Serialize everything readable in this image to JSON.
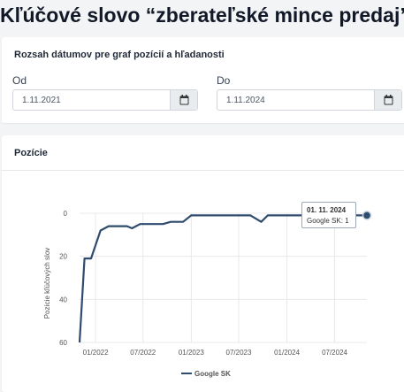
{
  "page": {
    "title": "Kľúčové slovo “zberateľské mince predaj”"
  },
  "date_range": {
    "title": "Rozsah dátumov pre graf pozícií a hľadanosti",
    "from_label": "Od",
    "from_value": "1.11.2021",
    "to_label": "Do",
    "to_value": "1.11.2024"
  },
  "positions_card": {
    "title": "Pozície"
  },
  "tooltip": {
    "date": "01. 11. 2024",
    "text": "Google SK: 1"
  },
  "colors": {
    "series": "#2f4b6e",
    "grid": "#e8e8e8"
  },
  "chart_data": {
    "type": "line",
    "ylabel": "Pozície kľúčových slov",
    "ylim": [
      0,
      60
    ],
    "y_reversed": true,
    "yticks": [
      0,
      20,
      40,
      60
    ],
    "xticks": [
      "01/2022",
      "07/2022",
      "01/2023",
      "07/2023",
      "01/2024",
      "07/2024"
    ],
    "xtick_positions": [
      "2022-01-01",
      "2022-07-01",
      "2023-01-01",
      "2023-07-01",
      "2024-01-01",
      "2024-07-01"
    ],
    "x_range": [
      "2021-11-01",
      "2024-11-01"
    ],
    "legend": "bottom",
    "series": [
      {
        "name": "Google SK",
        "x": [
          "2021-11-01",
          "2021-11-20",
          "2021-12-15",
          "2022-01-20",
          "2022-02-20",
          "2022-04-01",
          "2022-05-01",
          "2022-05-20",
          "2022-06-20",
          "2022-08-01",
          "2022-09-15",
          "2022-10-15",
          "2022-12-01",
          "2023-01-01",
          "2023-01-20",
          "2023-03-01",
          "2023-05-01",
          "2023-07-01",
          "2023-08-15",
          "2023-09-25",
          "2023-10-20",
          "2023-12-01",
          "2024-02-01",
          "2024-05-01",
          "2024-08-01",
          "2024-10-01",
          "2024-11-01"
        ],
        "values": [
          60,
          21,
          21,
          8,
          6,
          6,
          6,
          7,
          5,
          5,
          5,
          4,
          4,
          1,
          1,
          1,
          1,
          1,
          1,
          4,
          1,
          1,
          1,
          1,
          1,
          1,
          1
        ]
      }
    ]
  }
}
